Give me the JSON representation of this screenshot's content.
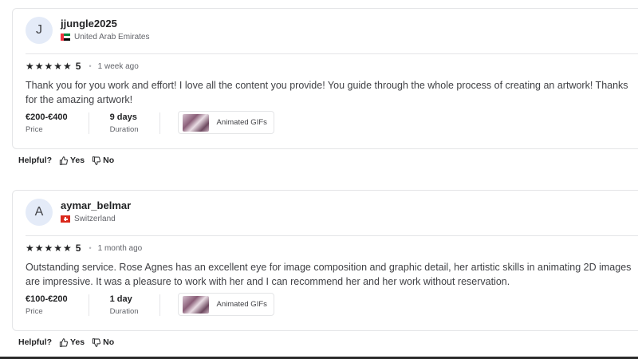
{
  "reviews": [
    {
      "avatar_letter": "J",
      "username": "jjungle2025",
      "country": "United Arab Emirates",
      "rating": "5",
      "time_ago": "1 week ago",
      "comment": "Thank you for you work and effort! I love all the content you provide! You guide through the whole process of creating an artwork! Thanks for the amazing artwork!",
      "price_value": "€200-€400",
      "price_label": "Price",
      "duration_value": "9 days",
      "duration_label": "Duration",
      "work_label": "Animated GIFs"
    },
    {
      "avatar_letter": "A",
      "username": "aymar_belmar",
      "country": "Switzerland",
      "rating": "5",
      "time_ago": "1 month ago",
      "comment": "Outstanding service. Rose Agnes has an excellent eye for image composition and graphic detail, her artistic skills in animating 2D images are impressive. It was a pleasure to work with her and I can recommend her and her work without reservation.",
      "price_value": "€100-€200",
      "price_label": "Price",
      "duration_value": "1 day",
      "duration_label": "Duration",
      "work_label": "Animated GIFs"
    }
  ],
  "helpful": {
    "question": "Helpful?",
    "yes": "Yes",
    "no": "No"
  },
  "stars_glyph": "★★★★★",
  "dot": "•"
}
